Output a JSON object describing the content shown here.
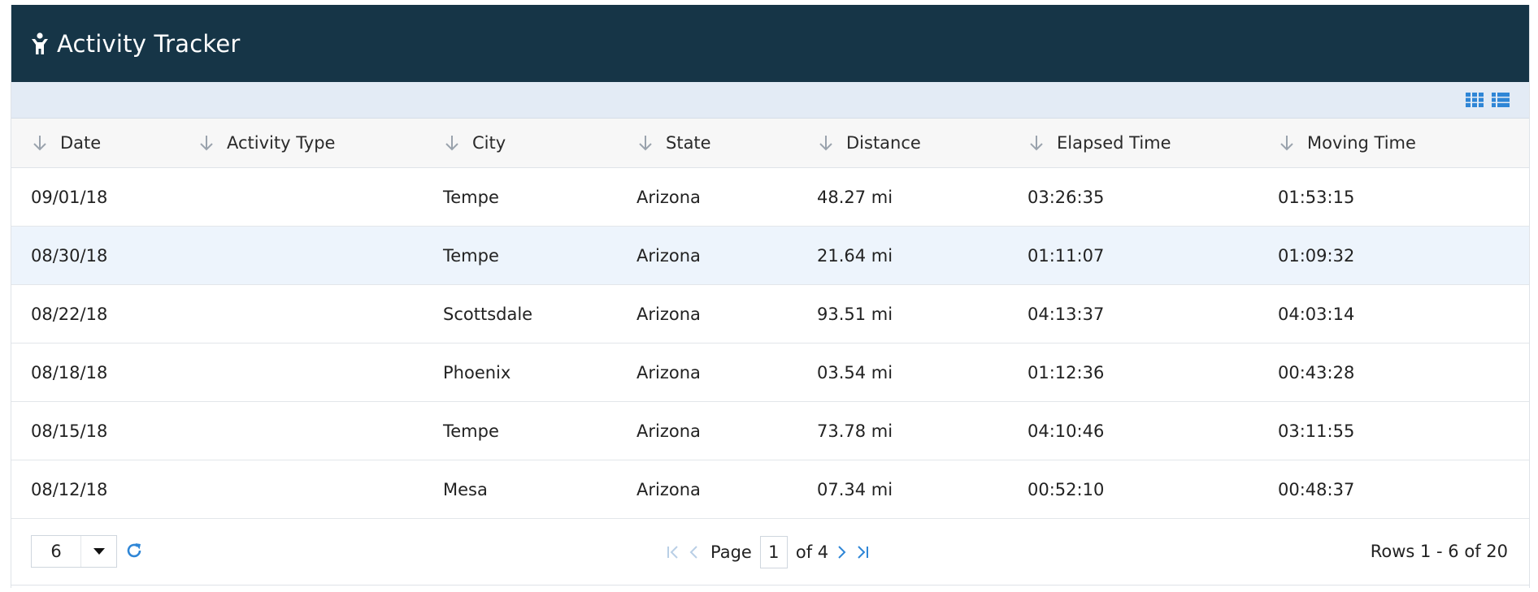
{
  "header": {
    "title": "Activity Tracker",
    "icon": "person-icon"
  },
  "toolbar": {
    "icons": [
      "grid-view-icon",
      "list-view-icon"
    ],
    "accent": "#2f86d6"
  },
  "columns": [
    "Date",
    "Activity Type",
    "City",
    "State",
    "Distance",
    "Elapsed Time",
    "Moving Time"
  ],
  "rows": [
    {
      "date": "09/01/18",
      "type": "",
      "city": "Tempe",
      "state": "Arizona",
      "distance": "48.27 mi",
      "elapsed": "03:26:35",
      "moving": "01:53:15"
    },
    {
      "date": "08/30/18",
      "type": "",
      "city": "Tempe",
      "state": "Arizona",
      "distance": "21.64 mi",
      "elapsed": "01:11:07",
      "moving": "01:09:32"
    },
    {
      "date": "08/22/18",
      "type": "",
      "city": "Scottsdale",
      "state": "Arizona",
      "distance": "93.51 mi",
      "elapsed": "04:13:37",
      "moving": "04:03:14"
    },
    {
      "date": "08/18/18",
      "type": "",
      "city": "Phoenix",
      "state": "Arizona",
      "distance": "03.54 mi",
      "elapsed": "01:12:36",
      "moving": "00:43:28"
    },
    {
      "date": "08/15/18",
      "type": "",
      "city": "Tempe",
      "state": "Arizona",
      "distance": "73.78 mi",
      "elapsed": "04:10:46",
      "moving": "03:11:55"
    },
    {
      "date": "08/12/18",
      "type": "",
      "city": "Mesa",
      "state": "Arizona",
      "distance": "07.34 mi",
      "elapsed": "00:52:10",
      "moving": "00:48:37"
    }
  ],
  "footer": {
    "page_size": "6",
    "page_label": "Page",
    "current_page": "1",
    "of_label": "of 4",
    "rows_info": "Rows 1 - 6 of 20"
  },
  "colors": {
    "header_bg": "#163547",
    "toolbar_bg": "#e3ebf5",
    "selected_row": "#edf4fc",
    "link": "#2f86d6"
  }
}
